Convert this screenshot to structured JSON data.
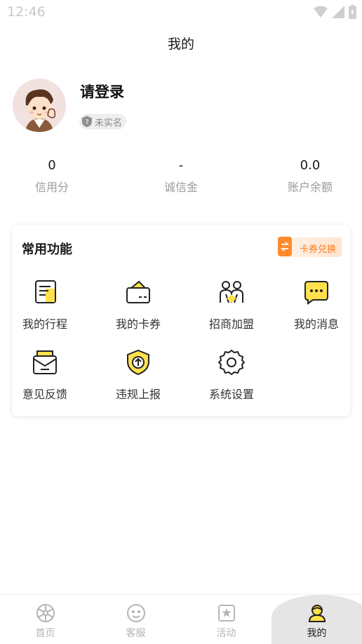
{
  "status_bar": {
    "time": "12:46"
  },
  "header": {
    "title": "我的"
  },
  "profile": {
    "login_text": "请登录",
    "realname_badge": "未实名"
  },
  "stats": [
    {
      "value": "0",
      "label": "信用分"
    },
    {
      "value": "-",
      "label": "诚信金"
    },
    {
      "value": "0.0",
      "label": "账户余额"
    }
  ],
  "functions": {
    "title": "常用功能",
    "coupon_exchange": "卡券兑换",
    "items": [
      {
        "label": "我的行程",
        "icon": "trip-icon"
      },
      {
        "label": "我的卡券",
        "icon": "coupon-wallet-icon"
      },
      {
        "label": "招商加盟",
        "icon": "partners-icon"
      },
      {
        "label": "我的消息",
        "icon": "message-icon"
      },
      {
        "label": "意见反馈",
        "icon": "feedback-icon"
      },
      {
        "label": "违规上报",
        "icon": "report-shield-icon"
      },
      {
        "label": "系统设置",
        "icon": "settings-gear-icon"
      }
    ]
  },
  "tabbar": [
    {
      "label": "首页",
      "icon": "home-icon",
      "active": false
    },
    {
      "label": "客服",
      "icon": "service-icon",
      "active": false
    },
    {
      "label": "活动",
      "icon": "activity-icon",
      "active": false
    },
    {
      "label": "我的",
      "icon": "profile-icon",
      "active": true
    }
  ],
  "colors": {
    "accent_yellow": "#ffe14d",
    "accent_orange": "#ff7a1a",
    "muted_text": "#9a9a9a"
  }
}
